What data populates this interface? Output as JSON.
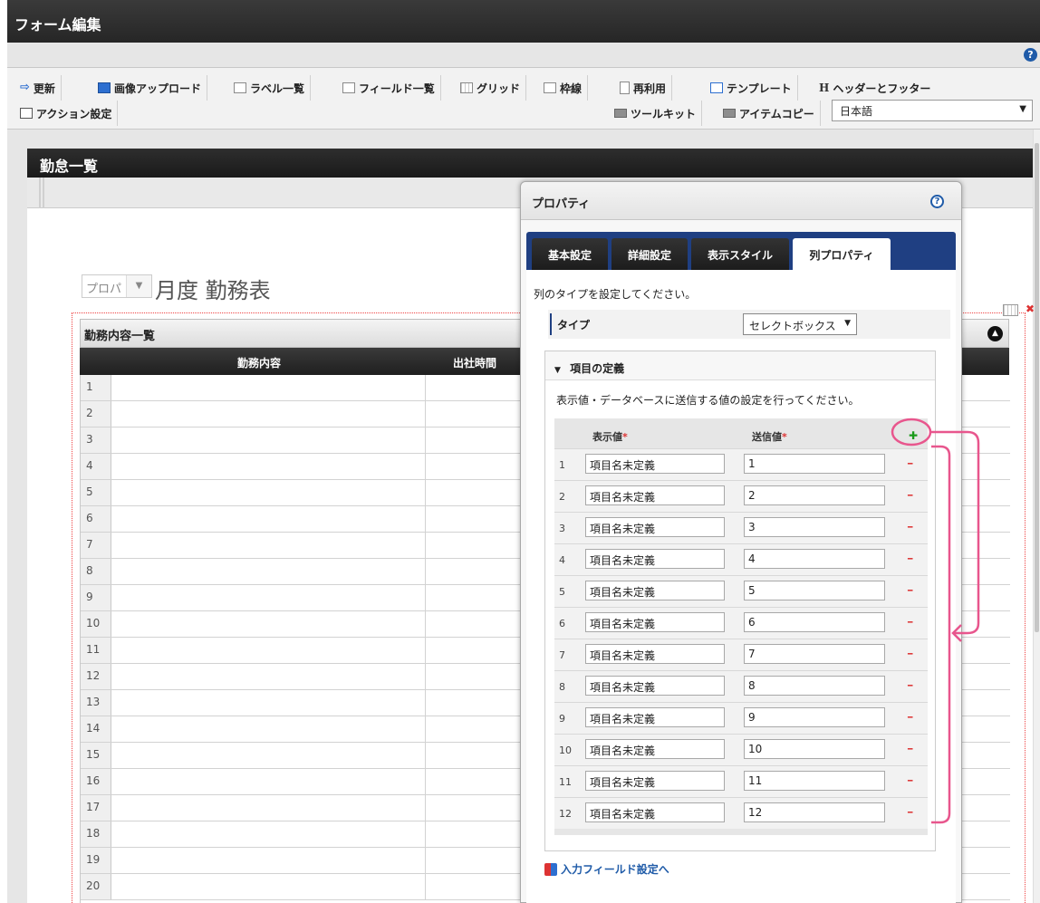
{
  "app": {
    "title": "フォーム編集"
  },
  "toolbar": {
    "row1": [
      {
        "label": "更新",
        "icon": "update-icon"
      },
      {
        "label": "画像アップロード",
        "icon": "image-upload-icon"
      },
      {
        "label": "ラベル一覧",
        "icon": "label-list-icon"
      },
      {
        "label": "フィールド一覧",
        "icon": "field-list-icon"
      },
      {
        "label": "グリッド",
        "icon": "grid-icon"
      },
      {
        "label": "枠線",
        "icon": "border-icon"
      },
      {
        "label": "再利用",
        "icon": "reuse-icon"
      },
      {
        "label": "テンプレート",
        "icon": "template-icon"
      },
      {
        "label": "ヘッダーとフッター",
        "icon": "header-footer-icon"
      }
    ],
    "action_label": "アクション設定",
    "toolkit_label": "ツールキット",
    "item_copy_label": "アイテムコピー",
    "language": "日本語"
  },
  "form": {
    "title": "勤怠一覧",
    "month_select": "プロパ",
    "month_title": "月度 勤務表",
    "grid": {
      "caption": "勤務内容一覧",
      "columns": [
        "勤務内容",
        "出社時間"
      ],
      "row_numbers": [
        "1",
        "2",
        "3",
        "4",
        "5",
        "6",
        "7",
        "8",
        "9",
        "10",
        "11",
        "12",
        "13",
        "14",
        "15",
        "16",
        "17",
        "18",
        "19",
        "20"
      ]
    }
  },
  "properties_panel": {
    "title": "プロパティ",
    "tabs": [
      "基本設定",
      "詳細設定",
      "表示スタイル",
      "列プロパティ"
    ],
    "active_tab": "列プロパティ",
    "instruction": "列のタイプを設定してください。",
    "type_label": "タイプ",
    "type_value": "セレクトボックス",
    "definition": {
      "title": "項目の定義",
      "instruction": "表示値・データベースに送信する値の設定を行ってください。",
      "col_display": "表示値",
      "col_send": "送信値",
      "required_mark": "*",
      "items": [
        {
          "no": "1",
          "display": "項目名未定義",
          "value": "1"
        },
        {
          "no": "2",
          "display": "項目名未定義",
          "value": "2"
        },
        {
          "no": "3",
          "display": "項目名未定義",
          "value": "3"
        },
        {
          "no": "4",
          "display": "項目名未定義",
          "value": "4"
        },
        {
          "no": "5",
          "display": "項目名未定義",
          "value": "5"
        },
        {
          "no": "6",
          "display": "項目名未定義",
          "value": "6"
        },
        {
          "no": "7",
          "display": "項目名未定義",
          "value": "7"
        },
        {
          "no": "8",
          "display": "項目名未定義",
          "value": "8"
        },
        {
          "no": "9",
          "display": "項目名未定義",
          "value": "9"
        },
        {
          "no": "10",
          "display": "項目名未定義",
          "value": "10"
        },
        {
          "no": "11",
          "display": "項目名未定義",
          "value": "11"
        },
        {
          "no": "12",
          "display": "項目名未定義",
          "value": "12"
        }
      ]
    },
    "link_label": "入力フィールド設定へ"
  },
  "colors": {
    "header_dark": "#262626",
    "tab_bar": "#1f3f82",
    "annotation": "#e8568d",
    "add": "#1a9a1a",
    "delete": "#d33333"
  }
}
